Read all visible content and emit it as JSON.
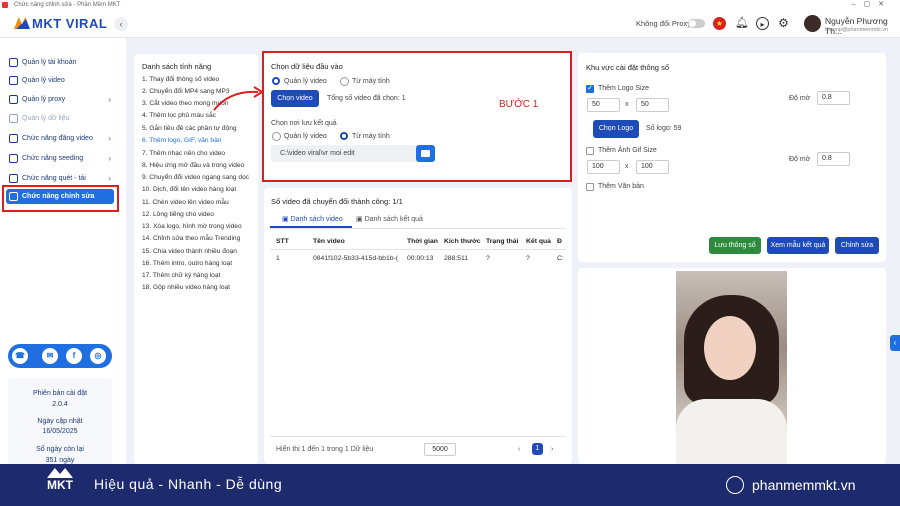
{
  "window": {
    "title": "Chức năng chỉnh sửa - Phần Mềm MKT"
  },
  "brand": {
    "logo_text": "MKT VIRAL",
    "accent": "#1f4bb8"
  },
  "header": {
    "proxy_label": "Không đổi Proxy",
    "user_name": "Nguyễn Phương Th...",
    "user_email": "thaonp@phanmemmkt.vn"
  },
  "sidebar": {
    "items": [
      {
        "label": "Quản lý tài khoản"
      },
      {
        "label": "Quản lý video"
      },
      {
        "label": "Quản lý proxy"
      },
      {
        "label": "Quản lý dữ liệu"
      },
      {
        "label": "Chức năng đăng video"
      },
      {
        "label": "Chức năng seeding"
      },
      {
        "label": "Chức năng quét - tải"
      },
      {
        "label": "Chức năng chỉnh sửa"
      }
    ],
    "version_label": "Phiên bản cài đặt",
    "version": "2.0.4",
    "update_label": "Ngày cập nhật",
    "update_date": "16/05/2025",
    "days_label": "Số ngày còn lại",
    "days_left": "351 ngày"
  },
  "features": {
    "title": "Danh sách tính năng",
    "items": [
      "1. Thay đổi thông số video",
      "2. Chuyển đổi MP4 sang MP3",
      "3. Cắt video theo mong muốn",
      "4. Thêm lọc phủ màu sắc",
      "5. Gắn tiêu đề các phần tự động",
      "6. Thêm logo, GIF, văn bản",
      "7. Thêm nhạc nền cho video",
      "8. Hiệu ứng mở đầu và trong video",
      "9. Chuyển đổi video ngang sang dọc",
      "10. Dịch, đổi tên video hàng loạt",
      "11. Chèn video lên video mẫu",
      "12. Lồng tiếng cho video",
      "13. Xóa logo, hình mờ trong video",
      "14. Chỉnh sửa theo mẫu Trending",
      "15. Chia video thành nhiều đoạn",
      "16. Thêm intro, outro hàng loạt",
      "17. Thêm chữ ký hàng loạt",
      "18. Gộp nhiều video hàng loạt"
    ]
  },
  "input_panel": {
    "title": "Chọn dữ liệu đầu vào",
    "opt_manage": "Quản lý video",
    "opt_computer": "Từ máy tính",
    "choose_btn": "Chọn video",
    "selected_count": "Tổng số video đã chọn: 1",
    "save_title": "Chọn nơi lưu kết quả",
    "save_manage": "Quản lý video",
    "save_computer": "Từ máy tính",
    "save_path": "C:\\video viral\\vr moi edit",
    "step_label": "BƯỚC 1"
  },
  "results": {
    "title": "Số video đã chuyển đổi thành công: 1/1",
    "tab_list": "Danh sách video",
    "tab_results": "Danh sách kết quả",
    "columns": [
      "STT",
      "Tên video",
      "Thời gian",
      "Kích thước",
      "Trạng thái",
      "Kết quả",
      "Đ"
    ],
    "rows": [
      [
        "1",
        "0841f102-5b33-415d-bb1b-(",
        "00:00:13",
        "288:511",
        "?",
        "?",
        "C:"
      ]
    ],
    "footer_text": "Hiển thị 1 đến 1 trong 1 Dữ liệu",
    "page_size": "5000",
    "page": "1"
  },
  "settings": {
    "title": "Khu vực cài đặt thông số",
    "logo_size_label": "Thêm Logo Size",
    "logo_w": "50",
    "logo_h": "50",
    "x": "x",
    "opacity_label": "Độ mờ",
    "logo_opacity": "0.8",
    "choose_logo_btn": "Chọn Logo",
    "logo_count": "Số logo: 59",
    "gif_size_label": "Thêm Ảnh Gif Size",
    "gif_w": "100",
    "gif_h": "100",
    "gif_opacity": "0.8",
    "text_label": "Thêm Văn bản",
    "save_btn": "Lưu thông số",
    "preview_btn": "Xem mẫu kết quả",
    "edit_btn": "Chỉnh sửa"
  },
  "footer": {
    "brand": "MKT",
    "slogan": "Hiệu quả - Nhanh - Dễ dùng",
    "website": "phanmemmkt.vn"
  }
}
